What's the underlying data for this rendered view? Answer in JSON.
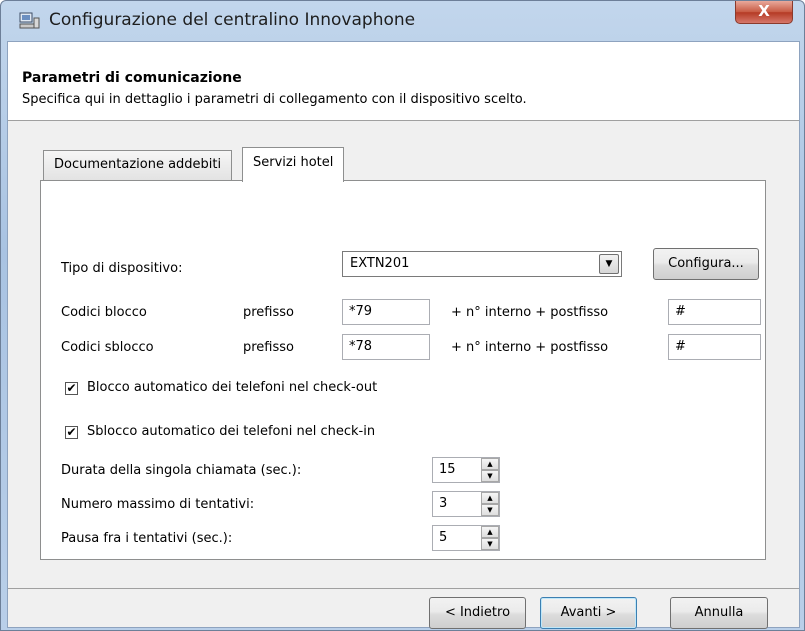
{
  "window": {
    "title": "Configurazione del centralino Innovaphone",
    "close_label": "X"
  },
  "header": {
    "title": "Parametri di comunicazione",
    "description": "Specifica qui in dettaglio i parametri di collegamento con il dispositivo scelto."
  },
  "tabs": [
    {
      "label": "Documentazione addebiti",
      "active": false
    },
    {
      "label": "Servizi hotel",
      "active": true
    }
  ],
  "device": {
    "label": "Tipo di dispositivo:",
    "value": "EXTN201",
    "configure_label": "Configura..."
  },
  "block_codes": {
    "label": "Codici blocco",
    "prefix_label": "prefisso",
    "prefix": "*79",
    "middle_label": "+ n° interno + postfisso",
    "suffix": "#"
  },
  "unblock_codes": {
    "label": "Codici sblocco",
    "prefix_label": "prefisso",
    "prefix": "*78",
    "middle_label": "+ n° interno + postfisso",
    "suffix": "#"
  },
  "checkboxes": [
    {
      "label": "Blocco automatico dei telefoni nel check-out",
      "checked": true
    },
    {
      "label": "Sblocco automatico dei telefoni nel check-in",
      "checked": true
    }
  ],
  "spinners": [
    {
      "label": "Durata della singola chiamata (sec.):",
      "value": "15"
    },
    {
      "label": "Numero massimo di tentativi:",
      "value": "3"
    },
    {
      "label": "Pausa fra i tentativi (sec.):",
      "value": "5"
    }
  ],
  "footer": {
    "back_label": "< Indietro",
    "next_label": "Avanti >",
    "cancel_label": "Annulla"
  },
  "icons": {
    "app": "computer-icon",
    "dropdown": "chevron-down-icon",
    "check": "checkmark-icon"
  }
}
